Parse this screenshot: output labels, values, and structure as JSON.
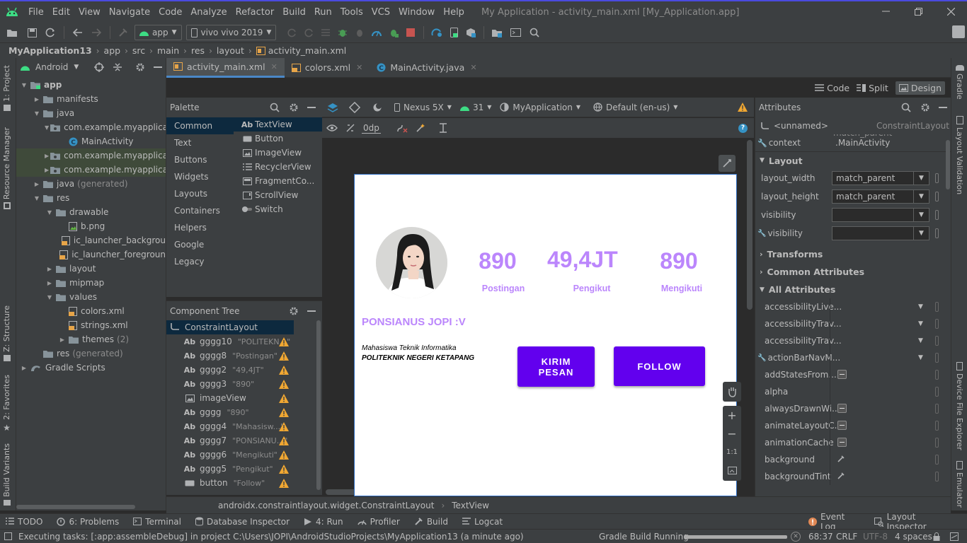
{
  "menu": {
    "items": [
      "File",
      "Edit",
      "View",
      "Navigate",
      "Code",
      "Analyze",
      "Refactor",
      "Build",
      "Run",
      "Tools",
      "VCS",
      "Window",
      "Help"
    ],
    "window_title": "My Application - activity_main.xml [My_Application.app]"
  },
  "toolbar": {
    "module": "app",
    "device": "vivo vivo 2019"
  },
  "breadcrumb": [
    "MyApplication13",
    "app",
    "src",
    "main",
    "res",
    "layout",
    "activity_main.xml"
  ],
  "left_stripe": {
    "project": "1: Project",
    "resource_manager": "Resource Manager",
    "structure": "Z: Structure",
    "favorites": "2: Favorites",
    "build_variants": "Build Variants"
  },
  "right_stripe": {
    "gradle": "Gradle",
    "layout_validation": "Layout Validation",
    "device_file_explorer": "Device File Explorer",
    "emulator": "Emulator"
  },
  "project": {
    "view_mode": "Android",
    "tree": [
      {
        "label": "app",
        "level": 0,
        "arrow": "down",
        "icon": "module",
        "bold": true
      },
      {
        "label": "manifests",
        "level": 1,
        "arrow": "right",
        "icon": "folder"
      },
      {
        "label": "java",
        "level": 1,
        "arrow": "down",
        "icon": "folder"
      },
      {
        "label": "com.example.myapplicat",
        "level": 2,
        "arrow": "down",
        "icon": "package"
      },
      {
        "label": "MainActivity",
        "level": 3,
        "arrow": "",
        "icon": "class"
      },
      {
        "label": "com.example.myapplicat",
        "level": 2,
        "arrow": "right",
        "icon": "package",
        "hl": true
      },
      {
        "label": "com.example.myapplicat",
        "level": 2,
        "arrow": "right",
        "icon": "package",
        "hl": true
      },
      {
        "label": "java",
        "suffix": "(generated)",
        "level": 1,
        "arrow": "right",
        "icon": "folder"
      },
      {
        "label": "res",
        "level": 1,
        "arrow": "down",
        "icon": "folder"
      },
      {
        "label": "drawable",
        "level": 2,
        "arrow": "down",
        "icon": "folder"
      },
      {
        "label": "b.png",
        "level": 3,
        "arrow": "",
        "icon": "image"
      },
      {
        "label": "ic_launcher_backgrou",
        "level": 3,
        "arrow": "",
        "icon": "xml"
      },
      {
        "label": "ic_launcher_foregroun",
        "level": 3,
        "arrow": "",
        "icon": "xml"
      },
      {
        "label": "layout",
        "level": 2,
        "arrow": "right",
        "icon": "folder"
      },
      {
        "label": "mipmap",
        "level": 2,
        "arrow": "right",
        "icon": "folder"
      },
      {
        "label": "values",
        "level": 2,
        "arrow": "down",
        "icon": "folder"
      },
      {
        "label": "colors.xml",
        "level": 3,
        "arrow": "",
        "icon": "xml"
      },
      {
        "label": "strings.xml",
        "level": 3,
        "arrow": "",
        "icon": "xml"
      },
      {
        "label": "themes",
        "suffix": "(2)",
        "level": 3,
        "arrow": "right",
        "icon": "folder"
      },
      {
        "label": "res",
        "suffix": "(generated)",
        "level": 1,
        "arrow": "",
        "icon": "folder"
      },
      {
        "label": "Gradle Scripts",
        "level": 0,
        "arrow": "right",
        "icon": "gradle"
      }
    ]
  },
  "tabs": [
    {
      "label": "activity_main.xml",
      "active": true
    },
    {
      "label": "colors.xml",
      "active": false
    },
    {
      "label": "MainActivity.java",
      "active": false
    }
  ],
  "view_modes": {
    "code": "Code",
    "split": "Split",
    "design": "Design"
  },
  "palette": {
    "title": "Palette",
    "categories": [
      "Common",
      "Text",
      "Buttons",
      "Widgets",
      "Layouts",
      "Containers",
      "Helpers",
      "Google",
      "Legacy"
    ],
    "items": [
      "TextView",
      "Button",
      "ImageView",
      "RecyclerView",
      "FragmentCo...",
      "ScrollView",
      "Switch"
    ]
  },
  "design_toolbar": {
    "device": "Nexus 5X",
    "api": "31",
    "theme": "MyApplication",
    "locale": "Default (en-us)",
    "margin": "0dp"
  },
  "component_tree": {
    "title": "Component Tree",
    "root": "ConstraintLayout",
    "items": [
      {
        "kind": "Ab",
        "id": "gggg10",
        "text": "\"POLITEKN...\""
      },
      {
        "kind": "Ab",
        "id": "gggg8",
        "text": "\"Postingan\""
      },
      {
        "kind": "Ab",
        "id": "gggg2",
        "text": "\"49,4JT\""
      },
      {
        "kind": "Ab",
        "id": "gggg3",
        "text": "\"890\""
      },
      {
        "kind": "img",
        "id": "imageView",
        "text": ""
      },
      {
        "kind": "Ab",
        "id": "gggg",
        "text": "\"890\""
      },
      {
        "kind": "Ab",
        "id": "gggg4",
        "text": "\"Mahasisw...\""
      },
      {
        "kind": "Ab",
        "id": "gggg7",
        "text": "\"PONSIANU...\""
      },
      {
        "kind": "Ab",
        "id": "gggg6",
        "text": "\"Mengikuti\""
      },
      {
        "kind": "Ab",
        "id": "gggg5",
        "text": "\"Pengikut\""
      },
      {
        "kind": "btn",
        "id": "button",
        "text": "\"Follow\""
      }
    ]
  },
  "preview": {
    "stat1_value": "890",
    "stat1_label": "Postingan",
    "stat2_value": "49,4JT",
    "stat2_label": "Pengikut",
    "stat3_value": "890",
    "stat3_label": "Mengikuti",
    "name": "PONSIANUS JOPI :V",
    "desc1": "Mahasiswa Teknik Informatika",
    "desc2": "POLITEKNIK NEGERI KETAPANG",
    "btn_message": "KIRIM PESAN",
    "btn_follow": "FOLLOW",
    "accent": "#bb86fc",
    "button_color": "#6200ee"
  },
  "zoom": {
    "one_to_one": "1:1"
  },
  "attributes": {
    "title": "Attributes",
    "component": "<unnamed>",
    "component_type": "ConstraintLayout",
    "partial_value": "match_parent",
    "context_label": "context",
    "context_value": ".MainActivity",
    "layout_section": "Layout",
    "layout_rows": [
      {
        "name": "layout_width",
        "value": "match_parent"
      },
      {
        "name": "layout_height",
        "value": "match_parent"
      },
      {
        "name": "visibility",
        "value": ""
      },
      {
        "name": "visibility",
        "value": "",
        "wrench": true
      }
    ],
    "sections": [
      "Transforms",
      "Common Attributes",
      "All Attributes"
    ],
    "all_rows": [
      {
        "name": "accessibilityLive...",
        "ctrl": "dd"
      },
      {
        "name": "accessibilityTrav...",
        "ctrl": "dd"
      },
      {
        "name": "accessibilityTrav...",
        "ctrl": "dd"
      },
      {
        "name": "actionBarNavM...",
        "ctrl": "dd",
        "wrench": true
      },
      {
        "name": "addStatesFrom...",
        "ctrl": "btn"
      },
      {
        "name": "alpha",
        "ctrl": ""
      },
      {
        "name": "alwaysDrawnWi...",
        "ctrl": "btn"
      },
      {
        "name": "animateLayoutC...",
        "ctrl": "btn"
      },
      {
        "name": "animationCache",
        "ctrl": "btn"
      },
      {
        "name": "background",
        "ctrl": "pick"
      },
      {
        "name": "backgroundTint",
        "ctrl": "pick"
      }
    ]
  },
  "bottom_path": [
    "androidx.constraintlayout.widget.ConstraintLayout",
    "TextView"
  ],
  "bottom_tools": [
    "TODO",
    "6: Problems",
    "Terminal",
    "Database Inspector",
    "4: Run",
    "Profiler",
    "Build",
    "Logcat"
  ],
  "bottom_tools_right": [
    "Event Log",
    "Layout Inspector"
  ],
  "status": {
    "message": "Executing tasks: [:app:assembleDebug] in project C:\\Users\\JOPI\\AndroidStudioProjects\\MyApplication13 (a minute ago)",
    "gradle": "Gradle Build Running",
    "position": "68:37",
    "line_sep": "CRLF",
    "encoding": "UTF-8",
    "indent": "4 spaces"
  }
}
